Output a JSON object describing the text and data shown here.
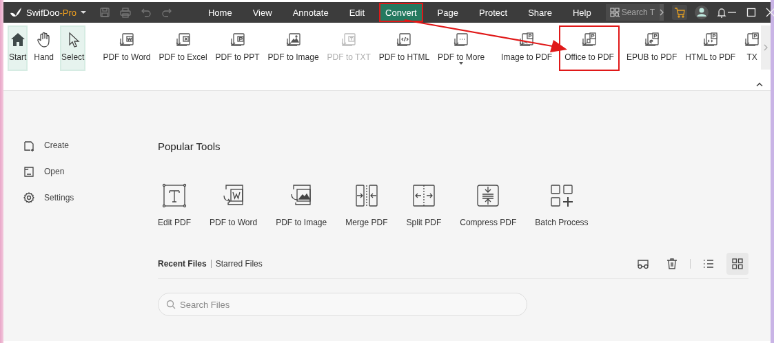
{
  "app": {
    "brand": "SwifDoo",
    "edition": "-Pro"
  },
  "menu": [
    {
      "label": "Home",
      "selected": false,
      "annotated": false
    },
    {
      "label": "View",
      "selected": false,
      "annotated": false
    },
    {
      "label": "Annotate",
      "selected": false,
      "annotated": false
    },
    {
      "label": "Edit",
      "selected": false,
      "annotated": false
    },
    {
      "label": "Convert",
      "selected": true,
      "annotated": true
    },
    {
      "label": "Page",
      "selected": false,
      "annotated": false
    },
    {
      "label": "Protect",
      "selected": false,
      "annotated": false
    },
    {
      "label": "Share",
      "selected": false,
      "annotated": false
    },
    {
      "label": "Help",
      "selected": false,
      "annotated": false
    }
  ],
  "search": {
    "placeholder": "Search T"
  },
  "ribbon": [
    {
      "label": "Start",
      "kind": "mode",
      "selected": true,
      "disabled": false,
      "dropdown": false,
      "annotated": false
    },
    {
      "label": "Hand",
      "kind": "mode",
      "selected": false,
      "disabled": false,
      "dropdown": false,
      "annotated": false
    },
    {
      "label": "Select",
      "kind": "mode",
      "selected": true,
      "disabled": false,
      "dropdown": false,
      "annotated": false
    },
    {
      "label": "PDF to Word",
      "kind": "tool",
      "selected": false,
      "disabled": false,
      "dropdown": false,
      "annotated": false
    },
    {
      "label": "PDF to Excel",
      "kind": "tool",
      "selected": false,
      "disabled": false,
      "dropdown": false,
      "annotated": false
    },
    {
      "label": "PDF to PPT",
      "kind": "tool",
      "selected": false,
      "disabled": false,
      "dropdown": false,
      "annotated": false
    },
    {
      "label": "PDF to Image",
      "kind": "tool",
      "selected": false,
      "disabled": false,
      "dropdown": false,
      "annotated": false
    },
    {
      "label": "PDF to TXT",
      "kind": "tool",
      "selected": false,
      "disabled": true,
      "dropdown": false,
      "annotated": false
    },
    {
      "label": "PDF to HTML",
      "kind": "tool",
      "selected": false,
      "disabled": false,
      "dropdown": false,
      "annotated": false
    },
    {
      "label": "PDF to More",
      "kind": "tool",
      "selected": false,
      "disabled": false,
      "dropdown": true,
      "annotated": false
    },
    {
      "label": "Image to PDF",
      "kind": "tool",
      "selected": false,
      "disabled": false,
      "dropdown": false,
      "annotated": false
    },
    {
      "label": "Office to PDF",
      "kind": "tool",
      "selected": false,
      "disabled": false,
      "dropdown": false,
      "annotated": true
    },
    {
      "label": "EPUB to PDF",
      "kind": "tool",
      "selected": false,
      "disabled": false,
      "dropdown": false,
      "annotated": false
    },
    {
      "label": "HTML to PDF",
      "kind": "tool",
      "selected": false,
      "disabled": false,
      "dropdown": false,
      "annotated": false
    },
    {
      "label": "TX",
      "kind": "tool",
      "selected": false,
      "disabled": false,
      "dropdown": false,
      "annotated": false
    }
  ],
  "annotation_arrow": true,
  "sidebar": {
    "items": [
      {
        "label": "Create"
      },
      {
        "label": "Open"
      },
      {
        "label": "Settings"
      }
    ]
  },
  "popular_tools": {
    "title": "Popular Tools",
    "items": [
      {
        "label": "Edit PDF"
      },
      {
        "label": "PDF to Word"
      },
      {
        "label": "PDF to Image"
      },
      {
        "label": "Merge PDF"
      },
      {
        "label": "Split PDF"
      },
      {
        "label": "Compress PDF"
      },
      {
        "label": "Batch Process"
      }
    ]
  },
  "files_tabs": [
    {
      "label": "Recent Files",
      "selected": true
    },
    {
      "label": "Starred Files",
      "selected": false
    }
  ],
  "file_view": [
    {
      "selected": false
    },
    {
      "selected": true
    }
  ],
  "search_files": {
    "placeholder": "Search Files"
  }
}
